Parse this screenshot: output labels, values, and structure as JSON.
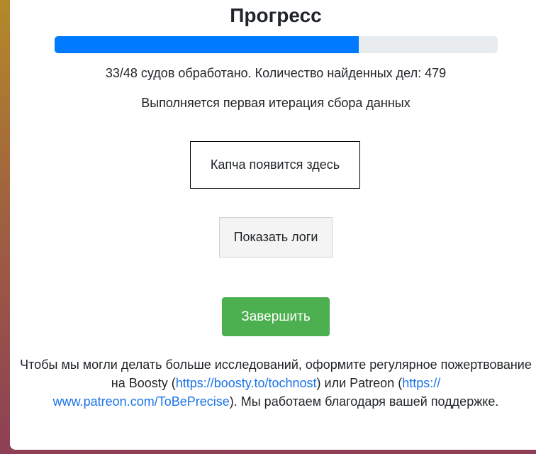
{
  "title": "Прогресс",
  "progress": {
    "fraction": 0.686
  },
  "status": {
    "courts": "33/48 судов обработано. Количество найденных дел: 479",
    "iteration": "Выполняется первая итерация сбора данных"
  },
  "captcha": {
    "placeholder": "Капча появится здесь"
  },
  "buttons": {
    "logs": "Показать логи",
    "finish": "Завершить"
  },
  "footer": {
    "text_1": "Чтобы мы могли делать больше исследований, оформите регулярное пожертвование на Boosty (",
    "boosty_link": "https://boosty.to/tochnost",
    "text_2": ") или Patreon (",
    "patreon_link": "https:// www.patreon.com/ToBePrecise",
    "text_3": "). Мы работаем благодаря вашей поддержке."
  },
  "colors": {
    "progress": "#007bff",
    "finish_button": "#4caf50",
    "link": "#1a73e8"
  }
}
